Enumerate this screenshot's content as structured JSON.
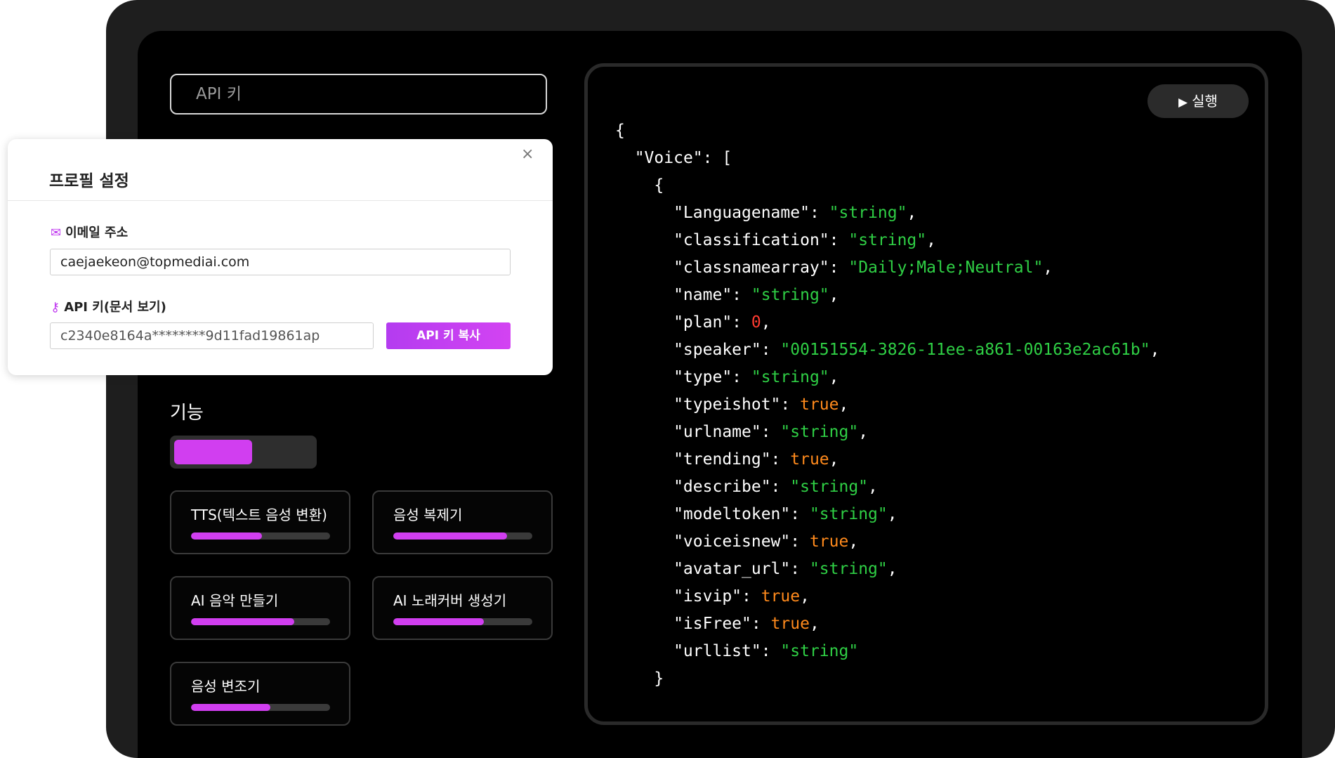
{
  "api_key_input": {
    "placeholder": "API 키"
  },
  "features": {
    "title": "기능",
    "toggle_fill": 0.53,
    "cards": [
      {
        "label": "TTS(텍스트 음성 변환)",
        "progress": 0.51
      },
      {
        "label": "음성 복제기",
        "progress": 0.82
      },
      {
        "label": "AI 음악 만들기",
        "progress": 0.74
      },
      {
        "label": "AI 노래커버 생성기",
        "progress": 0.65
      },
      {
        "label": "음성 변조기",
        "progress": 0.57
      }
    ]
  },
  "run_button": {
    "label": "실행",
    "icon": "play-icon"
  },
  "code": {
    "voice_key": "\"Voice\"",
    "languagename": "\"string\"",
    "classification": "\"string\"",
    "classnamearray": "\"Daily;Male;Neutral\"",
    "name": "\"string\"",
    "plan": "0",
    "speaker": "\"00151554-3826-11ee-a861-00163e2ac61b\"",
    "type": "\"string\"",
    "typeishot": "true",
    "urlname": "\"string\"",
    "trending": "true",
    "describe": "\"string\"",
    "modeltoken": "\"string\"",
    "voiceisnew": "true",
    "avatar_url": "\"string\"",
    "isvip": "true",
    "isFree": "true",
    "urllist": "\"string\""
  },
  "profile_modal": {
    "title": "프로필 설정",
    "close_icon": "×",
    "email_label": "이메일 주소",
    "email_value": "caejaekeon@topmediai.com",
    "api_key_label": "API 키(문서 보기)",
    "api_key_value": "c2340e8164a********9d11fad19861ap",
    "copy_button": "API 키 복사"
  },
  "colors": {
    "accent": "#d13ef0",
    "string": "#2fcf45",
    "number": "#ff3b30",
    "boolean": "#ff8a1c"
  }
}
